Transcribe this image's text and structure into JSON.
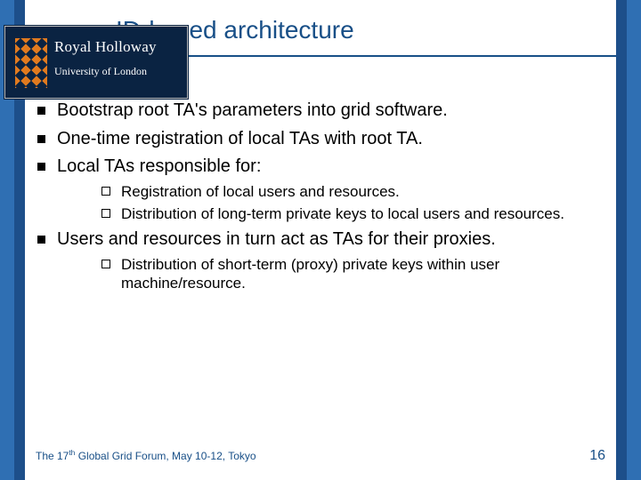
{
  "title": "ID-based architecture",
  "logo": {
    "line1": "Royal Holloway",
    "line2": "University of London"
  },
  "bullets": {
    "b1_0": "Bootstrap root TA's parameters into grid software.",
    "b1_1": "One-time registration of local TAs with root TA.",
    "b1_2": "Local TAs responsible for:",
    "b1_2_sub": {
      "s0": "Registration of local users and resources.",
      "s1": "Distribution of long-term private keys to local users and resources."
    },
    "b1_3": "Users and resources in turn act as TAs for their proxies.",
    "b1_3_sub": {
      "s0": "Distribution of short-term (proxy) private keys within user machine/resource."
    }
  },
  "footer": {
    "venue_prefix": "The 17",
    "venue_suffix": " Global Grid Forum, May 10-12, Tokyo",
    "ordinal": "th",
    "page": "16"
  }
}
